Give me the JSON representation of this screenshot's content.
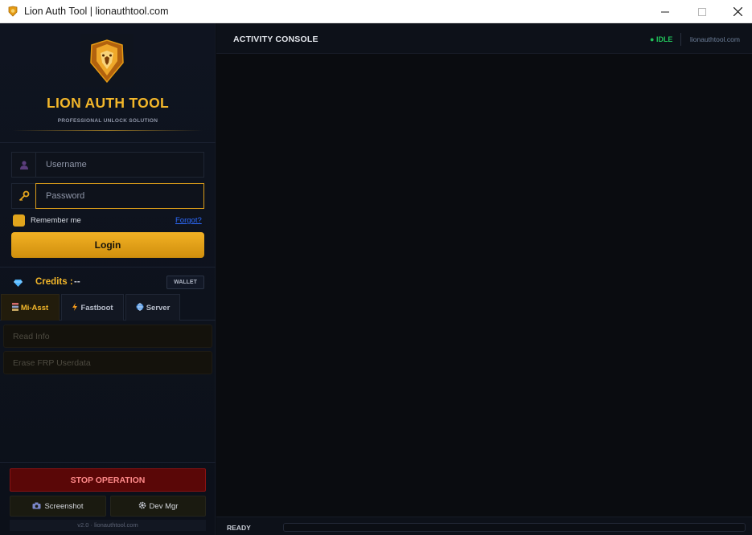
{
  "window": {
    "title": "Lion Auth Tool  |  lionauthtool.com",
    "controls": {
      "minimize_icon": "minimize-icon",
      "maximize_icon": "maximize-icon",
      "close_icon": "close-icon"
    }
  },
  "brand": {
    "name": "LION AUTH TOOL",
    "tagline": "PROFESSIONAL UNLOCK SOLUTION",
    "logo_icon": "lion-logo-icon",
    "accent_color": "#f3b72a"
  },
  "login": {
    "username_placeholder": "Username",
    "password_placeholder": "Password",
    "username_value": "",
    "password_value": "",
    "remember_label": "Remember me",
    "remember_checked": true,
    "forgot_label": "Forgot?",
    "login_label": "Login"
  },
  "credits": {
    "label": "Credits :",
    "value": "--",
    "wallet_label": "WALLET"
  },
  "tabs": [
    {
      "label": "Mi-Asst",
      "active": true,
      "icon": "stack-icon"
    },
    {
      "label": "Fastboot",
      "active": false,
      "icon": "bolt-icon"
    },
    {
      "label": "Server",
      "active": false,
      "icon": "globe-icon"
    }
  ],
  "actions": [
    {
      "label": "Read Info",
      "enabled": false
    },
    {
      "label": "Erase FRP  Userdata",
      "enabled": false
    }
  ],
  "bottom": {
    "stop_label": "STOP OPERATION",
    "screenshot_label": "Screenshot",
    "devmgr_label": "Dev Mgr",
    "version_text": "v2.0 · lionauthtool.com"
  },
  "console": {
    "title": "ACTIVITY CONSOLE",
    "status": "IDLE",
    "status_color": "#21c25a",
    "site": "lionauthtool.com"
  },
  "statusbar": {
    "ready_label": "READY",
    "progress": 0
  }
}
